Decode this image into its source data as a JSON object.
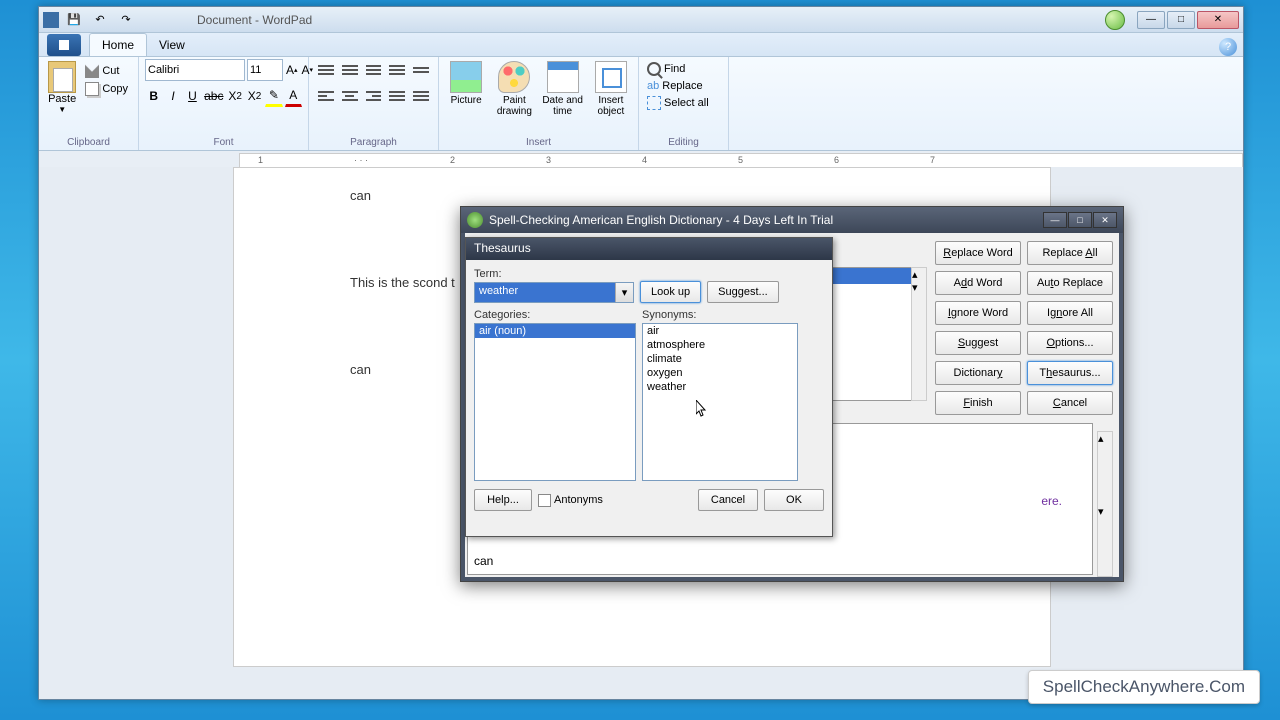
{
  "window": {
    "title": "Document - WordPad"
  },
  "tabs": {
    "home": "Home",
    "view": "View"
  },
  "ribbon": {
    "clipboard": {
      "label": "Clipboard",
      "paste": "Paste",
      "cut": "Cut",
      "copy": "Copy"
    },
    "font": {
      "label": "Font",
      "name": "Calibri",
      "size": "11"
    },
    "paragraph": {
      "label": "Paragraph"
    },
    "insert": {
      "label": "Insert",
      "picture": "Picture",
      "paint": "Paint\ndrawing",
      "date": "Date and\ntime",
      "object": "Insert\nobject"
    },
    "editing": {
      "label": "Editing",
      "find": "Find",
      "replace": "Replace",
      "selectall": "Select all"
    }
  },
  "ruler": [
    "1",
    "2",
    "3",
    "4",
    "5",
    "6",
    "7"
  ],
  "document": {
    "line1": "can",
    "line2": "This is the scond t",
    "line3": "can"
  },
  "spell": {
    "title": "Spell-Checking American English Dictionary - 4 Days Left In Trial",
    "bottom_text": "can",
    "link_fragment": "ere.",
    "buttons": {
      "replace_word": "Replace Word",
      "replace_all": "Replace All",
      "add_word": "Add Word",
      "auto_replace": "Auto Replace",
      "ignore_word": "Ignore Word",
      "ignore_all": "Ignore All",
      "suggest": "Suggest",
      "options": "Options...",
      "dictionary": "Dictionary",
      "thesaurus": "Thesaurus...",
      "finish": "Finish",
      "cancel": "Cancel"
    }
  },
  "thesaurus": {
    "title": "Thesaurus",
    "term_label": "Term:",
    "term_value": "weather",
    "lookup": "Look up",
    "suggest": "Suggest...",
    "categories_label": "Categories:",
    "synonyms_label": "Synonyms:",
    "categories": [
      "air (noun)"
    ],
    "synonyms": [
      "air",
      "atmosphere",
      "climate",
      "oxygen",
      "weather"
    ],
    "help": "Help...",
    "antonyms": "Antonyms",
    "cancel": "Cancel",
    "ok": "OK"
  },
  "watermark": "SpellCheckAnywhere.Com"
}
